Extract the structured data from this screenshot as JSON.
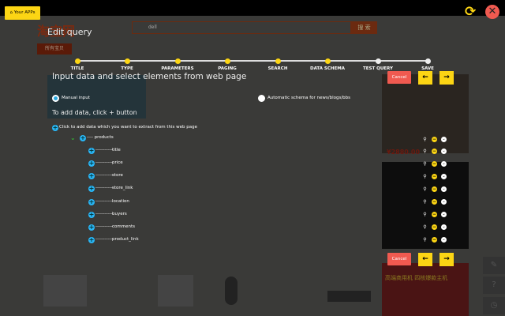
{
  "background": {
    "logo": "淘宝网",
    "search_value": "dell",
    "search_button": "搜 索",
    "nav_tab": "所有宝贝",
    "price": "¥2880.00",
    "banner": "高端商用机 四核爆款主机"
  },
  "header": {
    "your_apps": "Your APPs",
    "refresh_icon": "refresh-icon",
    "close_icon": "close-icon"
  },
  "dialog": {
    "title": "Edit query",
    "steps": [
      {
        "label": "TITLE",
        "done": true
      },
      {
        "label": "TYPE",
        "done": true
      },
      {
        "label": "PARAMETERS",
        "done": true
      },
      {
        "label": "PAGING",
        "done": true
      },
      {
        "label": "SEARCH",
        "done": true
      },
      {
        "label": "DATA SCHEMA",
        "done": true
      },
      {
        "label": "TEST QUERY",
        "done": false
      },
      {
        "label": "SAVE",
        "done": false
      }
    ],
    "heading": "Input data and select elements from web page",
    "radio_manual": "Manual input",
    "radio_auto": "Automatic schema for news/blogs/bbs",
    "subheading": "To add data, click + button",
    "add_hint": "Click to add data which you want to extract from this web page",
    "root": "---- products",
    "fields": [
      "title",
      "price",
      "store",
      "store_link",
      "location",
      "buyers",
      "comments",
      "product_link"
    ],
    "field_prefix": "-----------",
    "cancel": "Cancel",
    "prev_icon": "arrow-left-icon",
    "next_icon": "arrow-right-icon",
    "colors": {
      "accent": "#fcd514",
      "cancel": "#f05a50",
      "plus": "#29b6f6"
    }
  }
}
